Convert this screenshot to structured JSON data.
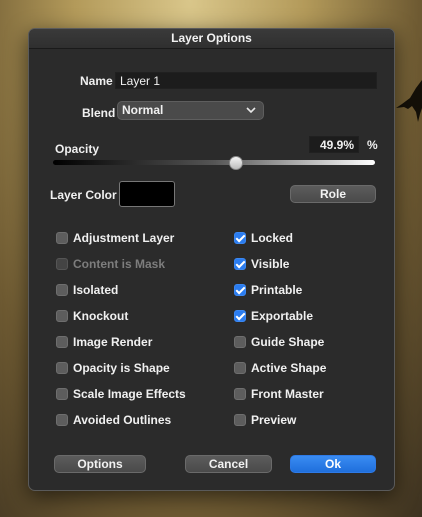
{
  "dialog": {
    "title": "Layer Options",
    "name_label": "Name",
    "name_value": "Layer 1",
    "blend_label": "Blend",
    "blend_value": "Normal",
    "opacity_label": "Opacity",
    "opacity_value": "49.9%",
    "opacity_fraction": 0.499,
    "opacity_unit": "%",
    "layer_color_label": "Layer Color",
    "layer_color": "#000000",
    "role_button": "Role",
    "checkboxes_left": [
      {
        "label": "Adjustment Layer",
        "checked": false,
        "enabled": true
      },
      {
        "label": "Content is Mask",
        "checked": false,
        "enabled": false
      },
      {
        "label": "Isolated",
        "checked": false,
        "enabled": true
      },
      {
        "label": "Knockout",
        "checked": false,
        "enabled": true
      },
      {
        "label": "Image Render",
        "checked": false,
        "enabled": true
      },
      {
        "label": "Opacity is Shape",
        "checked": false,
        "enabled": true
      },
      {
        "label": "Scale Image Effects",
        "checked": false,
        "enabled": true
      },
      {
        "label": "Avoided Outlines",
        "checked": false,
        "enabled": true
      }
    ],
    "checkboxes_right": [
      {
        "label": "Locked",
        "checked": true,
        "enabled": true
      },
      {
        "label": "Visible",
        "checked": true,
        "enabled": true
      },
      {
        "label": "Printable",
        "checked": true,
        "enabled": true
      },
      {
        "label": "Exportable",
        "checked": true,
        "enabled": true
      },
      {
        "label": "Guide Shape",
        "checked": false,
        "enabled": true
      },
      {
        "label": "Active Shape",
        "checked": false,
        "enabled": true
      },
      {
        "label": "Front Master",
        "checked": false,
        "enabled": true
      },
      {
        "label": "Preview",
        "checked": false,
        "enabled": true
      }
    ],
    "buttons": {
      "options": "Options",
      "cancel": "Cancel",
      "ok": "Ok"
    },
    "accent_color": "#2a7cf0"
  }
}
